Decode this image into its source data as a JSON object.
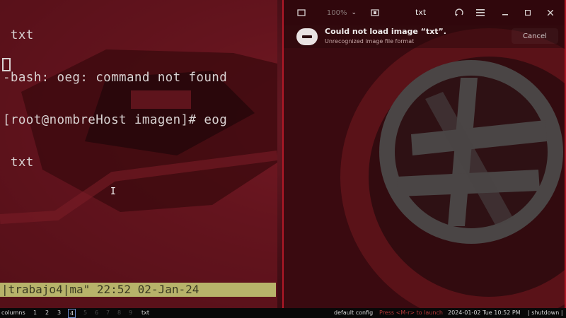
{
  "terminal": {
    "lines": [
      " txt",
      "-bash: oeg: command not found",
      "[root@nombreHost imagen]# eog",
      " txt"
    ],
    "status_line": "|trabajo4|ma\" 22:52 02-Jan-24"
  },
  "viewer": {
    "title": "txt",
    "zoom_label": "100%",
    "error_title": "Could not load image “txt”.",
    "error_detail": "Unrecognized image file format",
    "cancel_label": "Cancel",
    "icons": [
      "gallery-icon",
      "zoom-dropdown-icon",
      "slideshow-icon",
      "rotate-icon",
      "menu-icon",
      "minimize-icon",
      "maximize-icon",
      "close-icon"
    ]
  },
  "taskbar": {
    "layout_label": "columns",
    "workspaces": [
      "1",
      "2",
      "3",
      "4",
      "5",
      "6",
      "7",
      "8",
      "9"
    ],
    "active_workspace": "4",
    "window_title": "txt",
    "config_label": "default config",
    "hint_label": "Press <M-r> to launch",
    "clock": "2024-01-02 Tue 10:52 PM",
    "shutdown_label": "| shutdown |"
  },
  "colors": {
    "accent": "#b21827",
    "status_bar": "#b7b36a",
    "hint": "#b33a3a"
  }
}
